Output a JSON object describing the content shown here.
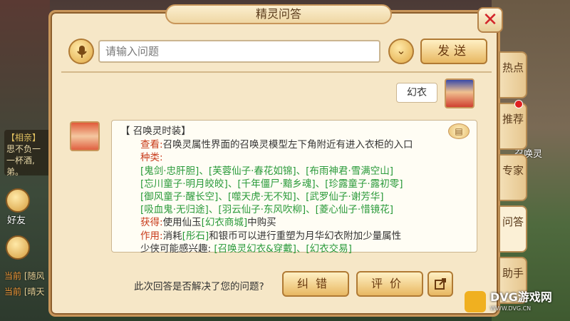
{
  "panel": {
    "title": "精灵问答",
    "search_placeholder": "请输入问题",
    "send_label": "发送"
  },
  "chat": {
    "user_message": "幻衣",
    "answer": {
      "heading": "【 召唤灵时装】",
      "view_label": "查看:",
      "view_text": "召唤灵属性界面的召唤灵模型左下角附近有进入衣柜的入口",
      "kinds_label": "种类:",
      "kinds_lines": [
        "[鬼剑·忠肝胆]、[芙蓉仙子·春花如锦]、[布雨神君·雪满空山]",
        "[忘川童子·明月皎皎]、[千年僵尸·黯乡魂]、[珍露童子·露初零]",
        "[御风童子·醒长空]、[噬天虎·无不知]、[武罗仙子·谢芳华]",
        "[吸血鬼·无归途]、[羽云仙子·东风吹柳]、[菱心仙子·惜镜花]"
      ],
      "obtain_label": "获得:",
      "obtain_text_pre": "使用仙玉",
      "obtain_link": "[幻衣商城]",
      "obtain_text_post": "中购买",
      "use_label": "作用:",
      "use_text_pre": "消耗",
      "use_link": "[彤石]",
      "use_text_post": "和银币可以进行重塑为月华幻衣附加少量属性",
      "interest_label": "少侠可能感兴趣:",
      "interest_links": "[召唤灵幻衣&穿戴]、[幻衣交易]"
    }
  },
  "footer": {
    "question": "此次回答是否解决了您的问题?",
    "fix_label": "纠错",
    "rate_label": "评价"
  },
  "side_tabs": [
    {
      "label": "热点"
    },
    {
      "label": "推荐"
    },
    {
      "label": "专家"
    },
    {
      "label": "问答"
    },
    {
      "label": "助手"
    }
  ],
  "background": {
    "chat_lines": [
      "【相亲】",
      "思不负一",
      "一杯酒,",
      "弟。"
    ],
    "friends_label": "好友",
    "channels": [
      {
        "tag": "当前",
        "text": "[随风"
      },
      {
        "tag": "当前",
        "text": "[晴天"
      }
    ],
    "scene_text": "召唤灵"
  },
  "watermark": {
    "brand": "DVG游戏网",
    "url": "WWW.DVG.CN"
  },
  "colors": {
    "label_red": "#c83a1a",
    "link_green": "#2a9a3a",
    "close_red": "#d3252a"
  },
  "icons": [
    "microphone-icon",
    "chevron-down-icon",
    "close-icon",
    "book-icon",
    "share-icon"
  ]
}
